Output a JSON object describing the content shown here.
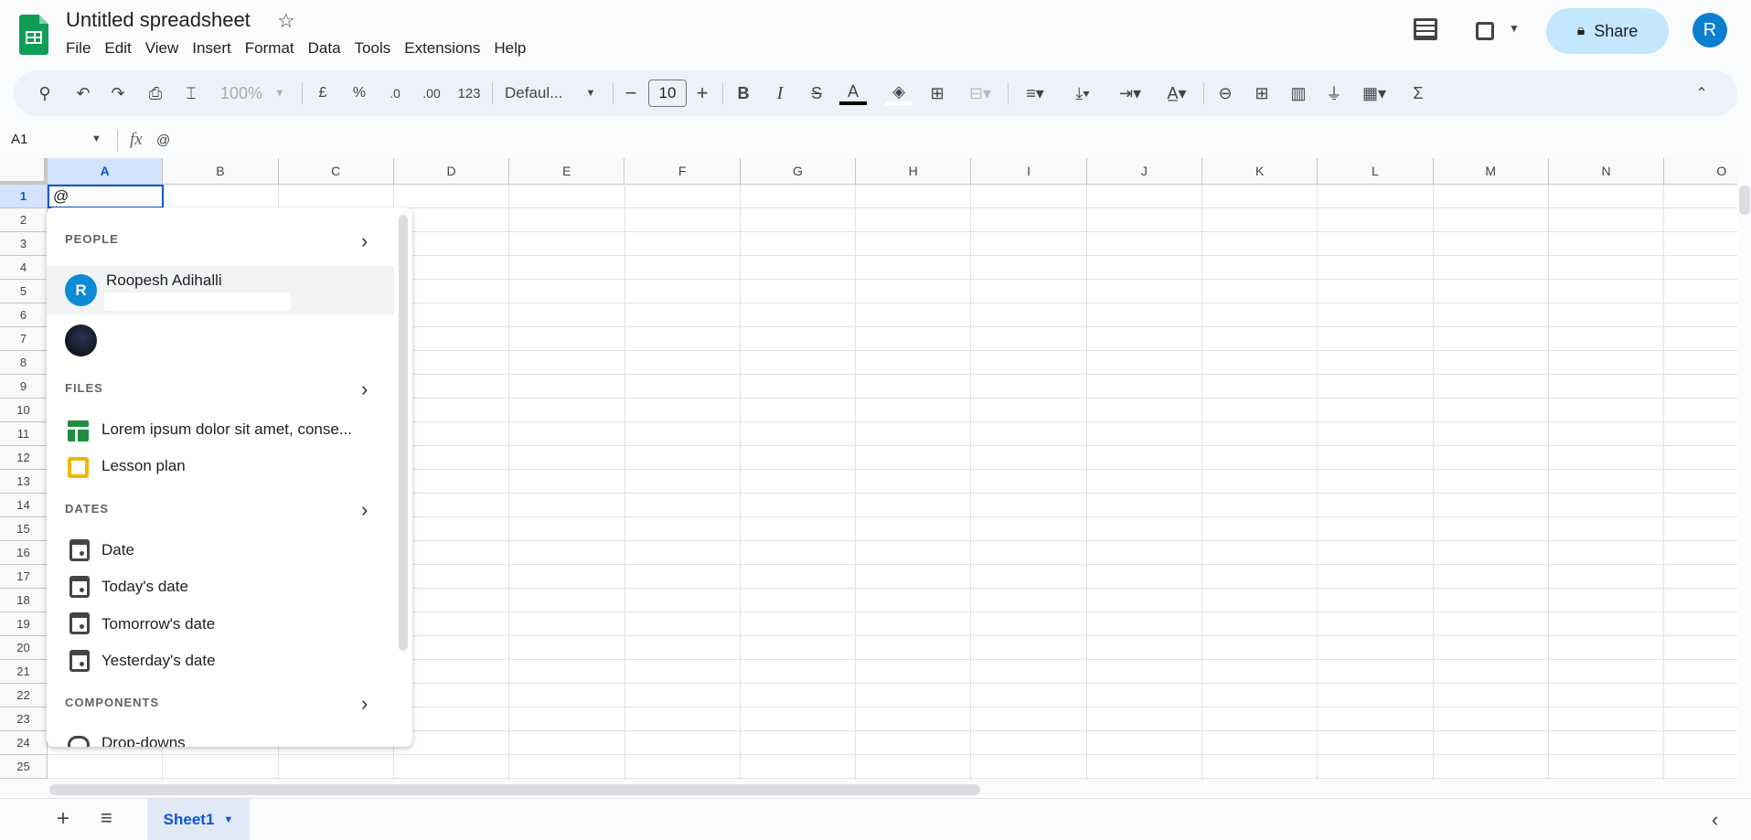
{
  "app": {
    "title": "Untitled spreadsheet",
    "share_label": "Share",
    "avatar_letter": "R",
    "accent": "#0b57d0",
    "brand": "#0f9d58"
  },
  "menu": [
    "File",
    "Edit",
    "View",
    "Insert",
    "Format",
    "Data",
    "Tools",
    "Extensions",
    "Help"
  ],
  "toolbar": {
    "zoom": "100%",
    "currency": "£",
    "percent": "%",
    "dec_less": ".0",
    "dec_more": ".00",
    "format_123": "123",
    "font": "Defaul...",
    "font_size": "10",
    "bold": "B",
    "italic": "I",
    "text_color": "A",
    "sum": "Σ"
  },
  "formula_bar": {
    "name_box": "A1",
    "fx": "fx",
    "value": "@"
  },
  "grid": {
    "columns": [
      "A",
      "B",
      "C",
      "D",
      "E",
      "F",
      "G",
      "H",
      "I",
      "J",
      "K",
      "L",
      "M",
      "N",
      "O"
    ],
    "row_count": 25,
    "active_cell": "A1",
    "active_value": "@"
  },
  "dropdown": {
    "people_label": "PEOPLE",
    "person_name": "Roopesh Adihalli",
    "person_initial": "R",
    "files_label": "FILES",
    "files": [
      "Lorem ipsum dolor sit amet, conse...",
      "Lesson plan"
    ],
    "dates_label": "DATES",
    "dates": [
      "Date",
      "Today's date",
      "Tomorrow's date",
      "Yesterday's date"
    ],
    "components_label": "COMPONENTS",
    "components": [
      "Drop-downs"
    ]
  },
  "sheets": {
    "active": "Sheet1"
  }
}
